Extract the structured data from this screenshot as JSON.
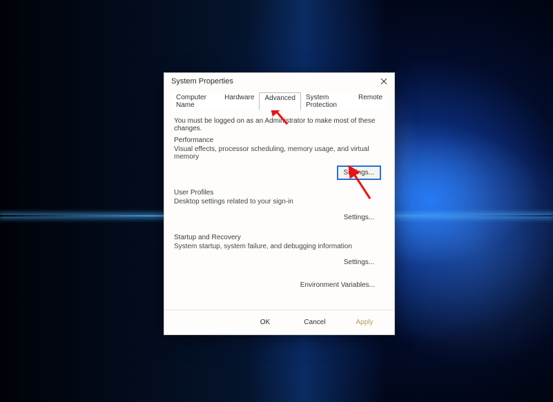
{
  "dialog": {
    "title": "System Properties",
    "tabs": [
      {
        "label": "Computer Name"
      },
      {
        "label": "Hardware"
      },
      {
        "label": "Advanced"
      },
      {
        "label": "System Protection"
      },
      {
        "label": "Remote"
      }
    ],
    "active_tab_index": 2,
    "admin_note": "You must be logged on as an Administrator to make most of these changes.",
    "sections": {
      "performance": {
        "title": "Performance",
        "desc": "Visual effects, processor scheduling, memory usage, and virtual memory",
        "button": "Settings..."
      },
      "user_profiles": {
        "title": "User Profiles",
        "desc": "Desktop settings related to your sign-in",
        "button": "Settings..."
      },
      "startup": {
        "title": "Startup and Recovery",
        "desc": "System startup, system failure, and debugging information",
        "button": "Settings..."
      }
    },
    "env_button": "Environment Variables...",
    "buttons": {
      "ok": "OK",
      "cancel": "Cancel",
      "apply": "Apply"
    }
  }
}
